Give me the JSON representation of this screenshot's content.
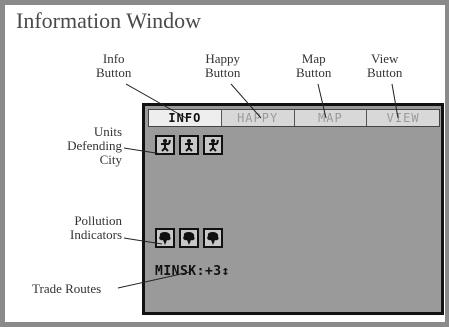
{
  "window": {
    "title": "Information Window"
  },
  "callouts": {
    "info_button": "Info\nButton",
    "happy_button": "Happy\nButton",
    "map_button": "Map\nButton",
    "view_button": "View\nButton",
    "units_defending": "Units\nDefending\nCity",
    "pollution_indicators": "Pollution\nIndicators",
    "trade_routes": "Trade Routes"
  },
  "screen": {
    "tabs": [
      {
        "label": "INFO",
        "active": true
      },
      {
        "label": "HAPPY",
        "active": false
      },
      {
        "label": "MAP",
        "active": false
      },
      {
        "label": "VIEW",
        "active": false
      }
    ],
    "units": [
      "soldier-icon",
      "soldier-icon",
      "soldier-icon"
    ],
    "pollution": [
      "pollution-icon",
      "pollution-icon",
      "pollution-icon"
    ],
    "trade_route": "MINSK:+3↕"
  }
}
